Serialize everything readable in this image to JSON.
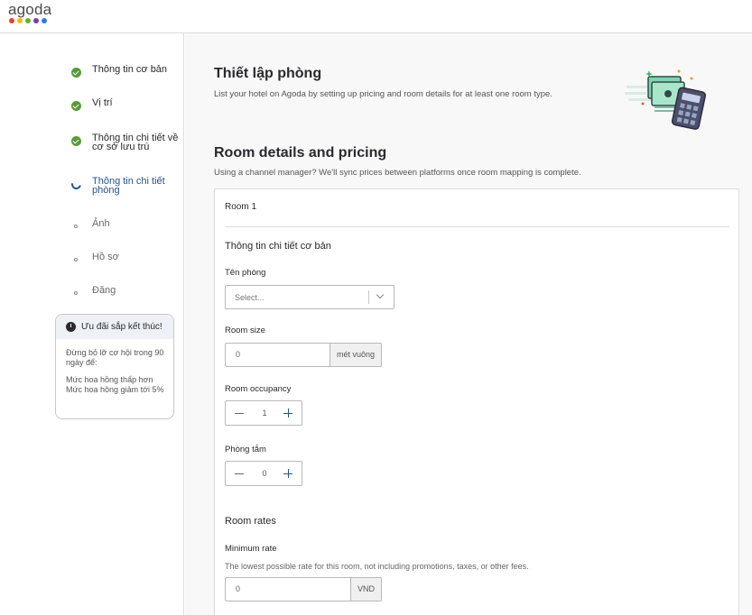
{
  "brand": {
    "name": "agoda",
    "dot_colors": [
      "#e8432b",
      "#f9b900",
      "#5fb336",
      "#7b3fa1",
      "#2d7ae0"
    ]
  },
  "sidebar": {
    "steps": [
      {
        "label": "Thông tin cơ bản",
        "status": "completed"
      },
      {
        "label": "Vị trí",
        "status": "completed"
      },
      {
        "label": "Thông tin chi tiết về cơ sở lưu trú",
        "status": "completed"
      },
      {
        "label": "Thông tin chi tiết phòng",
        "status": "in-progress"
      },
      {
        "label": "Ảnh",
        "status": "pending"
      },
      {
        "label": "Hồ sơ",
        "status": "pending"
      },
      {
        "label": "Đăng",
        "status": "pending"
      }
    ],
    "promo": {
      "title": "Ưu đãi sắp kết thúc!",
      "body": "Đừng bỏ lỡ cơ hội trong 90 ngày để:",
      "benefit_1": "Mức hoa hồng thấp hơn",
      "benefit_2": "Mức hoa hồng giảm tới 5%"
    }
  },
  "main": {
    "page_title": "Thiết lập phòng",
    "page_desc": "List your hotel on Agoda by setting up pricing and room details for at least one room type.",
    "section_title": "Room details and pricing",
    "section_desc": "Using a channel manager? We'll sync prices between platforms once room mapping is complete.",
    "room": {
      "title": "Room 1",
      "basic_info_title": "Thông tin chi tiết cơ bản",
      "room_name": {
        "label": "Tên phòng",
        "placeholder": "Select..."
      },
      "room_size": {
        "label": "Room size",
        "value": "0",
        "unit": "mét vuông"
      },
      "room_occupancy": {
        "label": "Room occupancy",
        "value": "1"
      },
      "bathrooms": {
        "label": "Phòng tắm",
        "value": "0"
      },
      "rates_title": "Room rates",
      "minimum_rate": {
        "label": "Minimum rate",
        "hint": "The lowest possible rate for this room, not including promotions, taxes, or other fees.",
        "value": "0",
        "currency": "VND"
      }
    }
  },
  "colors": {
    "accent": "#25558d",
    "completed": "#5a9a3a"
  }
}
